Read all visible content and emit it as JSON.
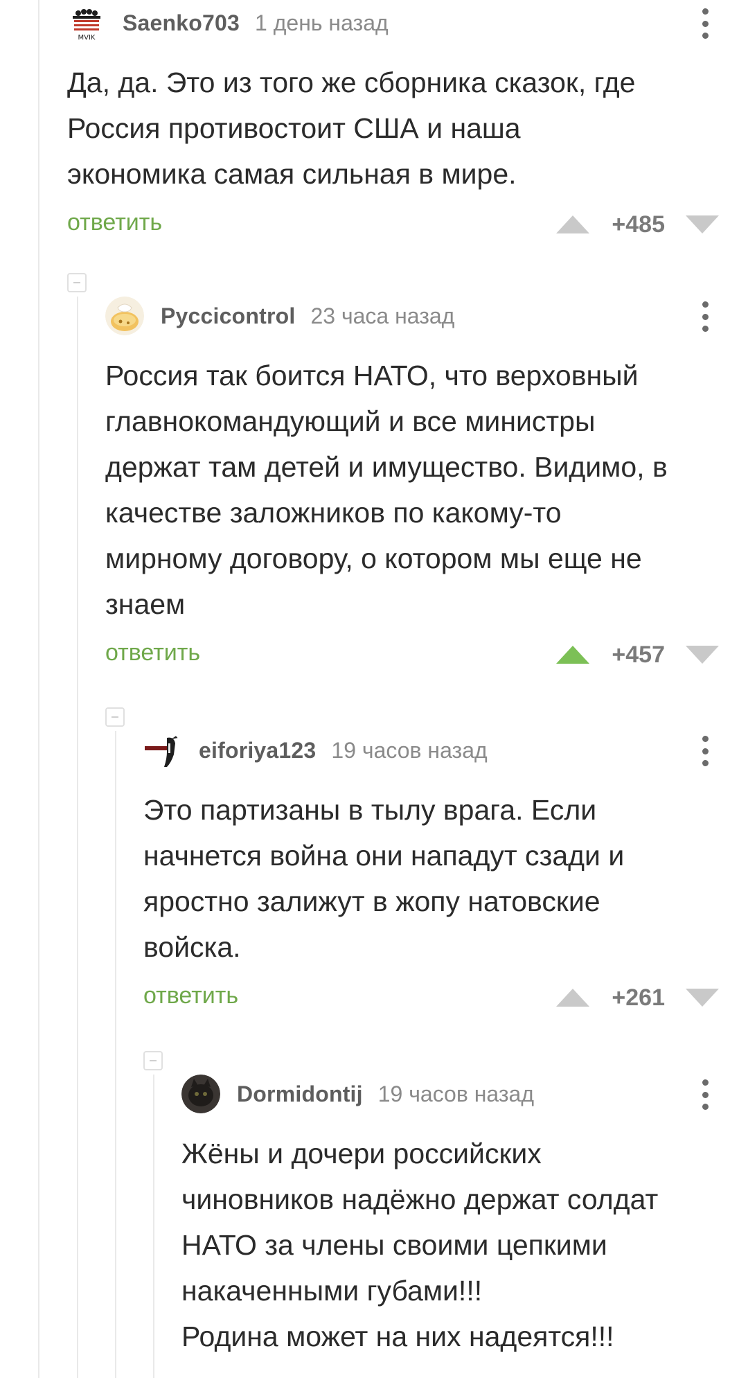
{
  "colors": {
    "reply_link": "#6fa84a",
    "vote_active": "#7cc056",
    "vote_inactive": "#c9c9c9",
    "username": "#5e5e5e",
    "time": "#8a8a8a"
  },
  "comments": [
    {
      "username": "Saenko703",
      "time": "1 день назад",
      "text": "Да, да. Это из того же сборника сказок, где\nРоссия противостоит США и наша\nэкономика самая сильная в мире.",
      "reply_label": "ответить",
      "score": "+485",
      "upvoted": false,
      "avatar_icon": "avatar-image-icon"
    },
    {
      "username": "Pyccicontrol",
      "time": "23 часа назад",
      "text": "Россия так боится НАТО, что верховный\nглавнокомандующий и все министры\nдержат там детей и имущество. Видимо, в\nкачестве заложников по какому-то\nмирному договору, о котором мы еще не\nзнаем",
      "reply_label": "ответить",
      "score": "+457",
      "upvoted": true,
      "avatar_icon": "avatar-image-icon"
    },
    {
      "username": "eiforiya123",
      "time": "19 часов назад",
      "text": "Это партизаны в тылу врага. Если\nначнется война они нападут сзади и\nяростно залижут в жопу натовские\nвойска.",
      "reply_label": "ответить",
      "score": "+261",
      "upvoted": false,
      "avatar_icon": "avatar-image-icon"
    },
    {
      "username": "Dormidontij",
      "time": "19 часов назад",
      "text": "Жёны и дочери российских\nчиновников надёжно держат солдат\nНАТО за члены своими цепкими\nнакаченными губами!!!\nРодина может на них надеятся!!!",
      "avatar_icon": "avatar-image-icon"
    }
  ]
}
